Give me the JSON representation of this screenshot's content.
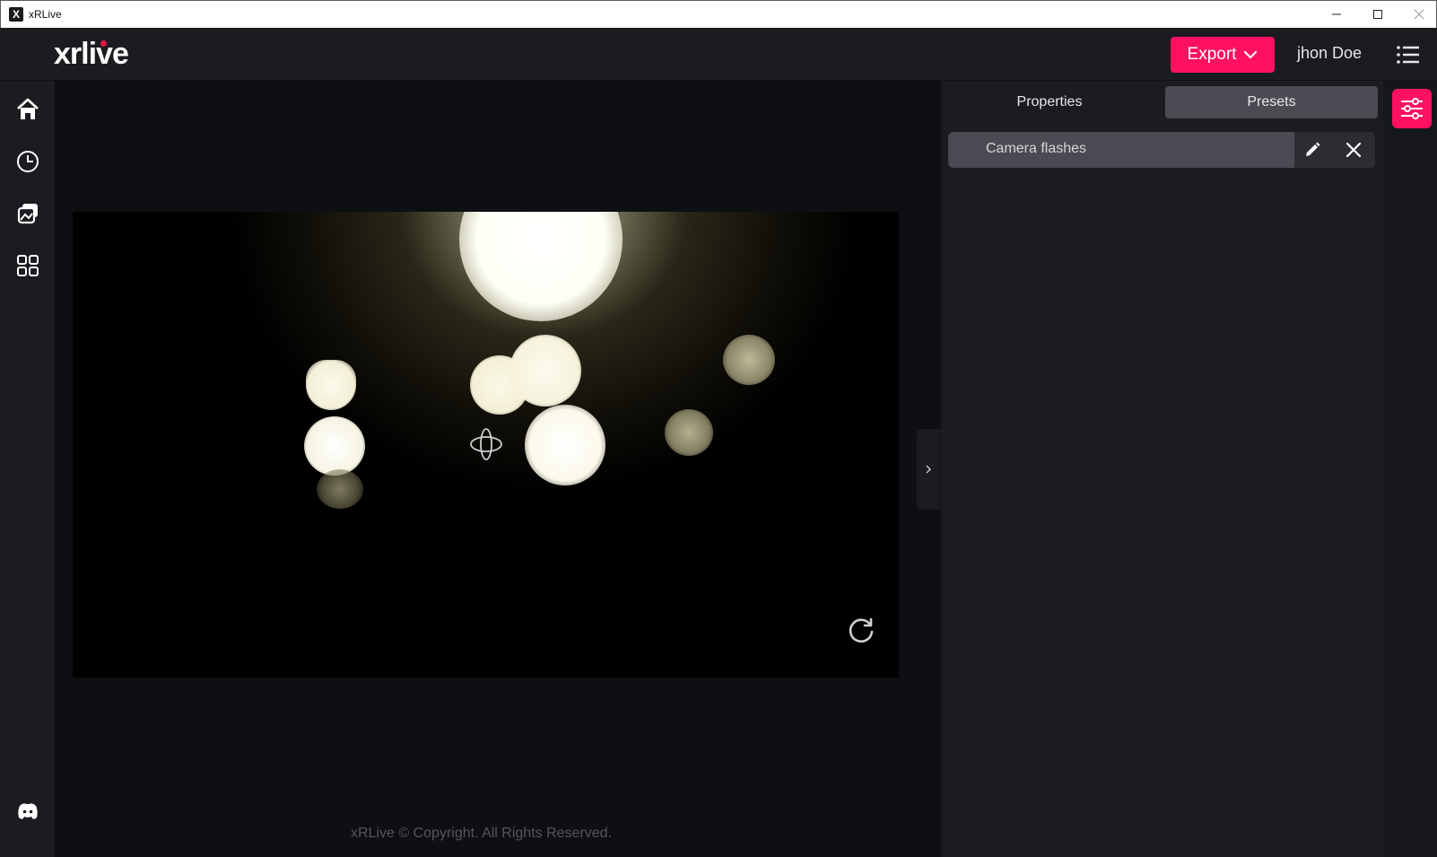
{
  "window": {
    "title": "xRLive"
  },
  "header": {
    "logo_text": "xrlive",
    "export_label": "Export",
    "user_name": "jhon Doe"
  },
  "sidebar": {
    "items": [
      {
        "name": "home",
        "icon": "home-icon"
      },
      {
        "name": "history",
        "icon": "clock-icon"
      },
      {
        "name": "gallery",
        "icon": "gallery-icon"
      },
      {
        "name": "apps",
        "icon": "grid-icon"
      },
      {
        "name": "discord",
        "icon": "discord-icon"
      }
    ]
  },
  "right_panel": {
    "tabs": [
      {
        "label": "Properties",
        "active": false
      },
      {
        "label": "Presets",
        "active": true
      }
    ],
    "presets": [
      {
        "name": "Camera flashes"
      }
    ]
  },
  "footer": {
    "text": "xRLive © Copyright. All Rights Reserved."
  },
  "colors": {
    "accent": "#ff1160",
    "background": "#0e0f13",
    "panel": "#1b1c20"
  }
}
